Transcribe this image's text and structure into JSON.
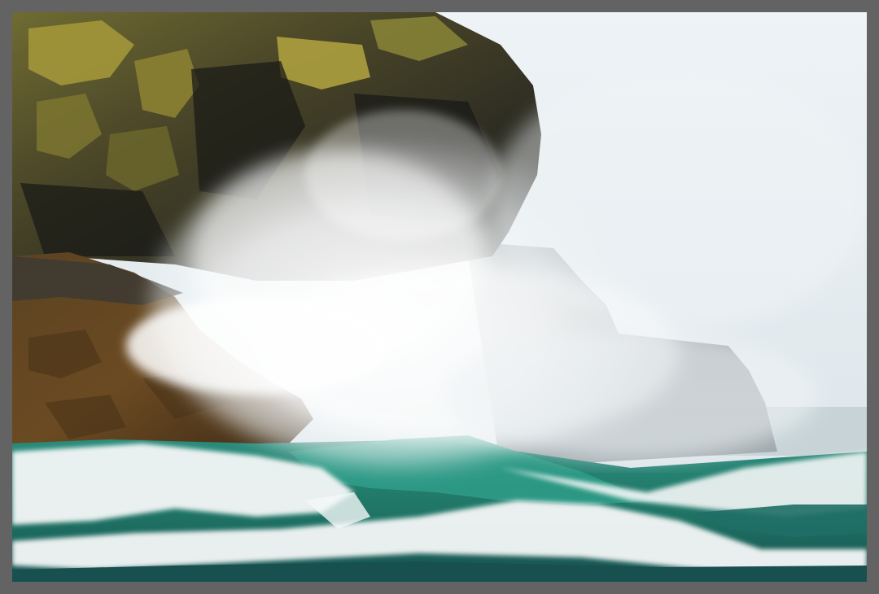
{
  "photo": {
    "subject": "ocean-wave-crashing-on-rocky-cliff",
    "palette": {
      "frame": "#636363",
      "sky": "#e3eaef",
      "rock_dark": "#2a2a22",
      "rock_lichen": "#a79a3a",
      "rock_brown": "#6b4a22",
      "sea_teal": "#1f7d6e",
      "sea_deep": "#1a5558",
      "foam": "#f4f7f7"
    }
  }
}
